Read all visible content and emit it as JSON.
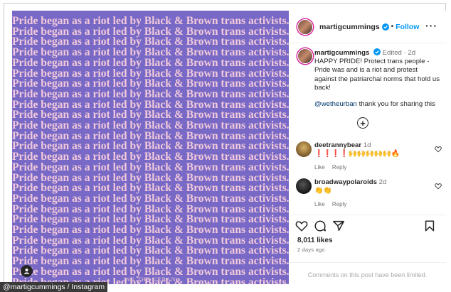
{
  "image": {
    "repeat_text": "Pride began as a riot led by Black & Brown trans activists.",
    "repeat_count": 26,
    "watermark": "WE THE URBAN",
    "background_color": "#7769c5",
    "text_color": "#f3cadb"
  },
  "header": {
    "username": "martigcummings",
    "follow_label": "Follow",
    "more_icon": "more-icon"
  },
  "caption": {
    "username": "martigcummings",
    "edited": "Edited",
    "time": "2d",
    "text": "HAPPY PRIDE! Protect trans people - Pride was and is a riot and protest against the patriarchal norms that hold us back!",
    "mention": "@wetheurban",
    "mention_text": "thank you for sharing this"
  },
  "comments": [
    {
      "username": "deetrannybear",
      "time": "1d",
      "text": "❗❗❗❗🙌🙌🙌🙌🙌🔥",
      "like_label": "Like",
      "reply_label": "Reply"
    },
    {
      "username": "broadwaypolaroids",
      "time": "2d",
      "text": "👏👏",
      "like_label": "Like",
      "reply_label": "Reply"
    }
  ],
  "stats": {
    "likes": "8,011 likes",
    "posted": "2 days ago"
  },
  "comments_limited": "Comments on this post have been limited.",
  "credit": "@martigcummings / Instagram",
  "colors": {
    "accent": "#0095f6",
    "muted": "#737373"
  }
}
